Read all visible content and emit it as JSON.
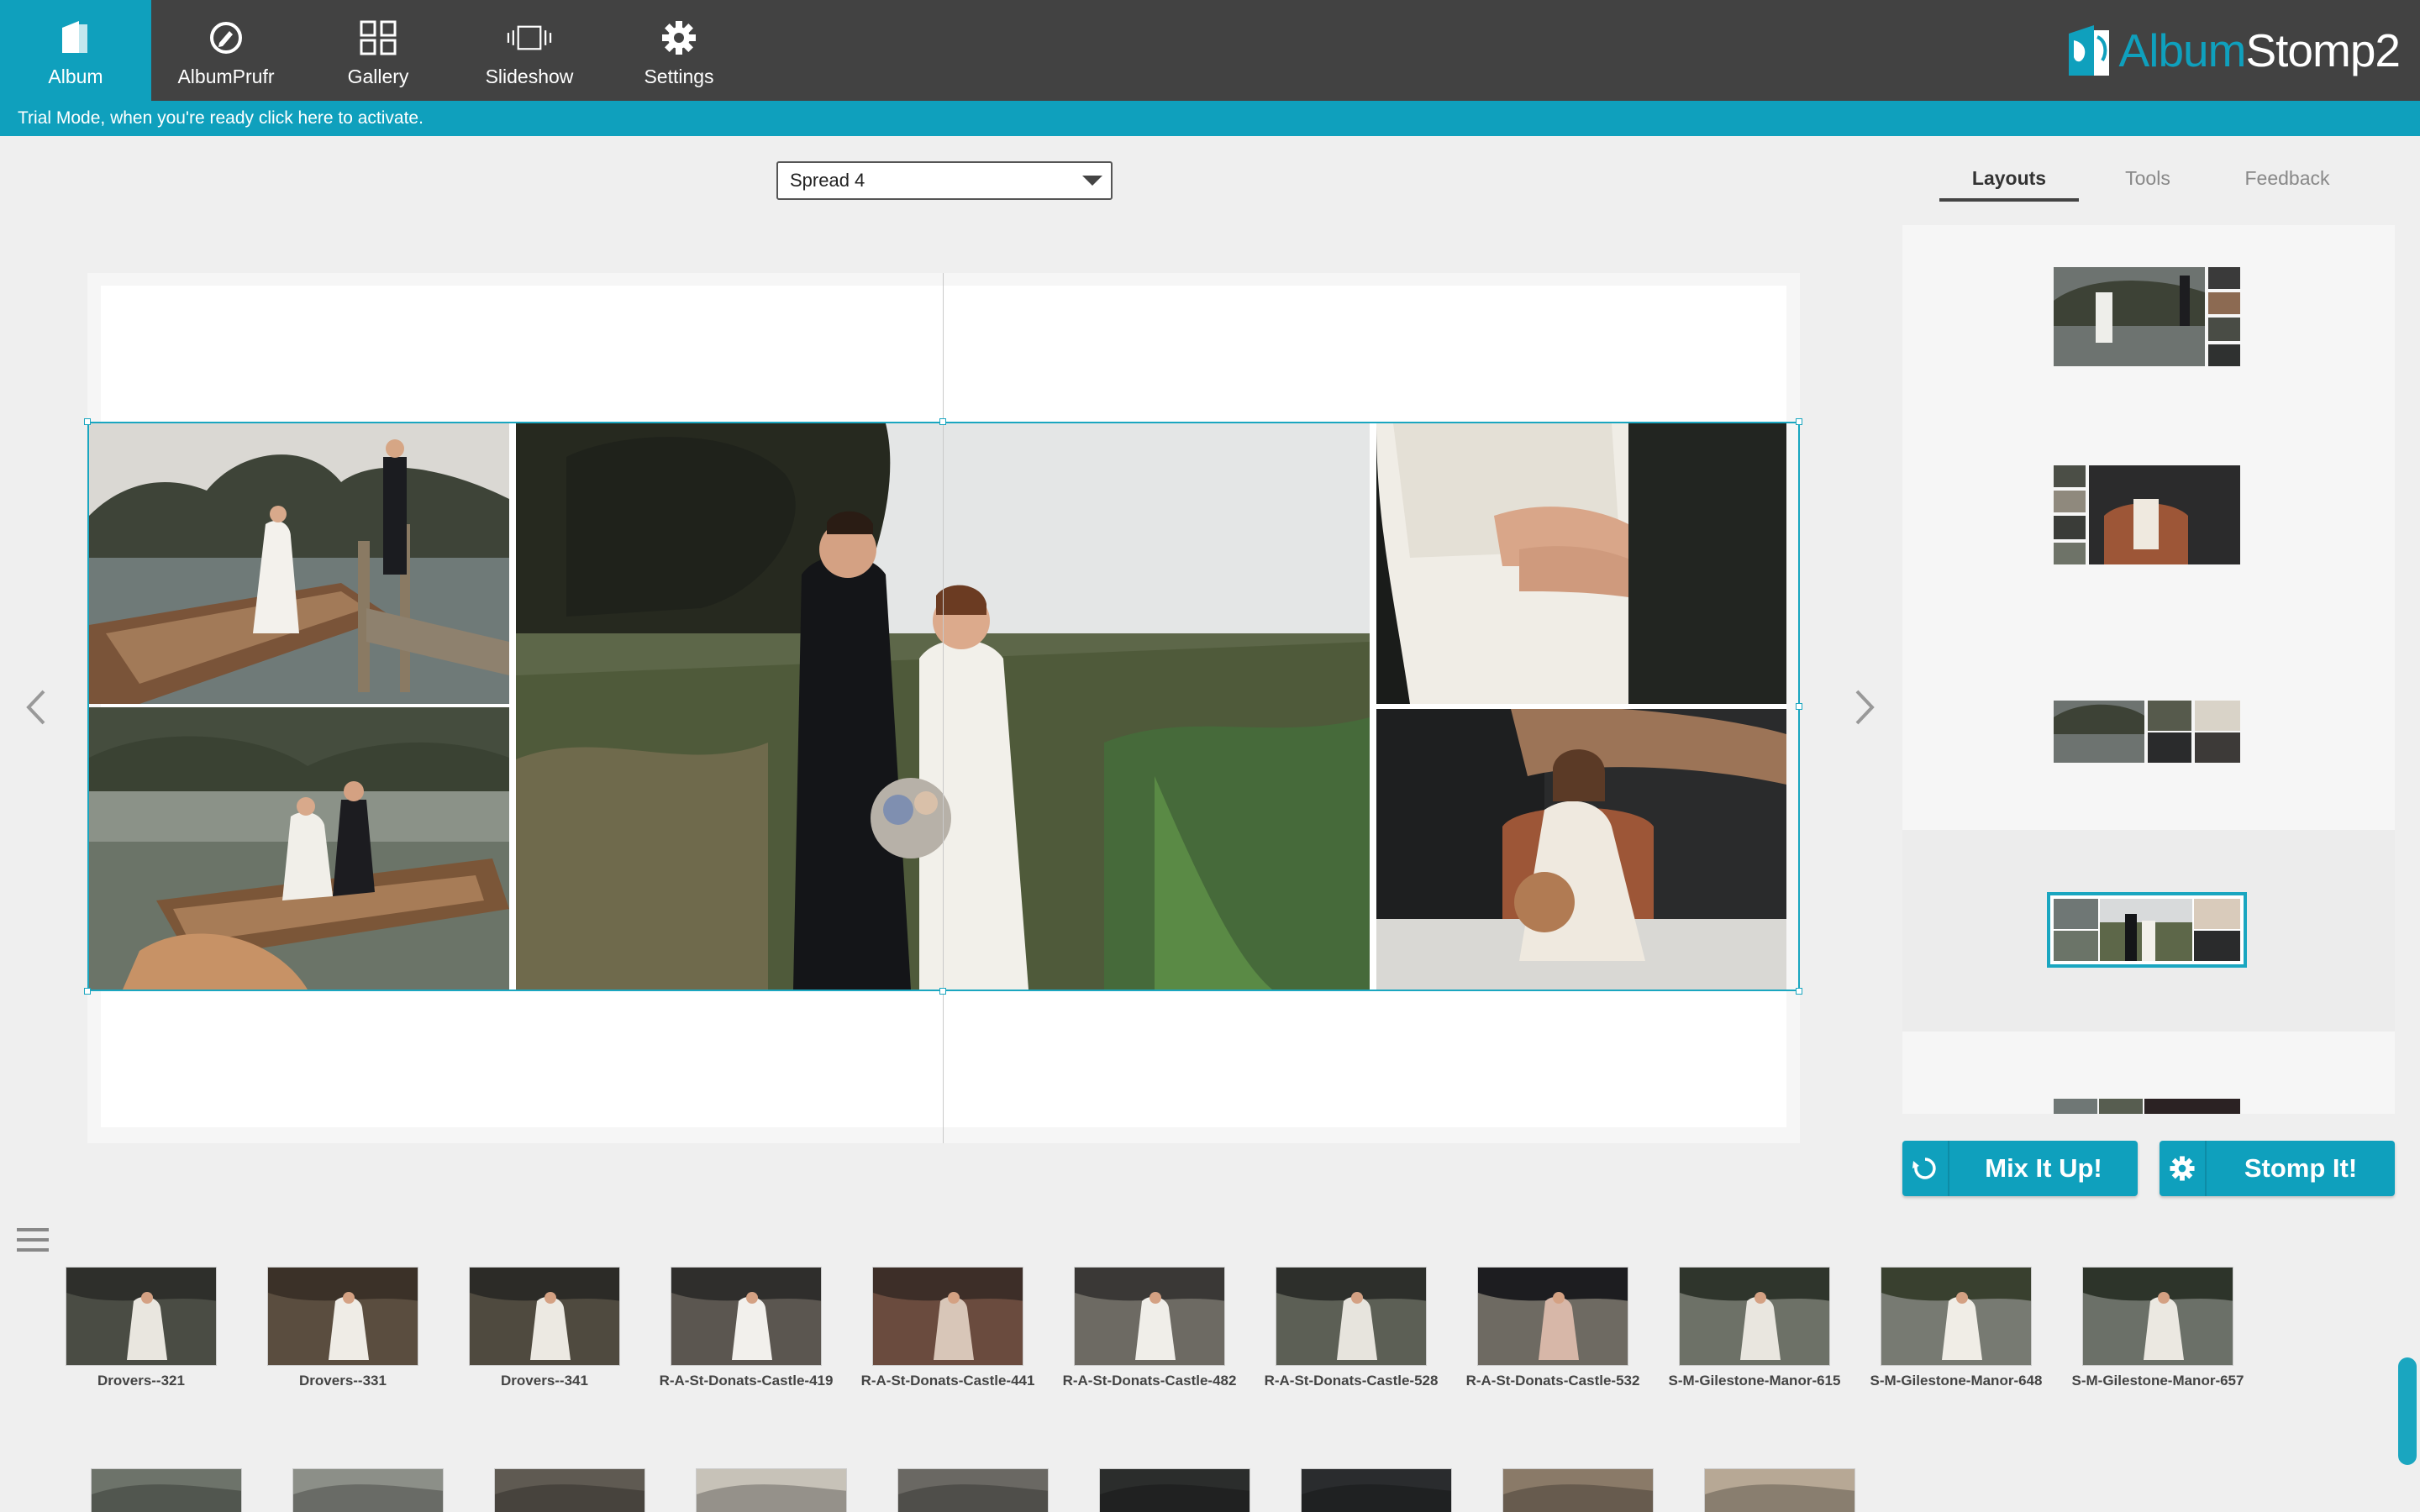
{
  "nav": {
    "items": [
      {
        "label": "Album",
        "icon": "album-icon"
      },
      {
        "label": "AlbumPrufr",
        "icon": "albumprufr-icon"
      },
      {
        "label": "Gallery",
        "icon": "gallery-icon"
      },
      {
        "label": "Slideshow",
        "icon": "slideshow-icon"
      },
      {
        "label": "Settings",
        "icon": "gear-icon"
      }
    ],
    "active": "Album"
  },
  "brand": {
    "part1": "Album",
    "part2": "Stomp2"
  },
  "trial": {
    "message": "Trial Mode, when you're ready click here to activate."
  },
  "spread_select": {
    "value": "Spread 4"
  },
  "tabs": [
    {
      "label": "Layouts",
      "active": true
    },
    {
      "label": "Tools",
      "active": false
    },
    {
      "label": "Feedback",
      "active": false
    }
  ],
  "buttons": {
    "mix": "Mix It Up!",
    "stomp": "Stomp It!"
  },
  "filmstrip": {
    "row1": [
      "Drovers--321",
      "Drovers--331",
      "Drovers--341",
      "R-A-St-Donats-Castle-419",
      "R-A-St-Donats-Castle-441",
      "R-A-St-Donats-Castle-482",
      "R-A-St-Donats-Castle-528",
      "R-A-St-Donats-Castle-532",
      "S-M-Gilestone-Manor-615",
      "S-M-Gilestone-Manor-648",
      "S-M-Gilestone-Manor-657"
    ]
  },
  "colors": {
    "accent": "#0fa0bd",
    "nav_bg": "#424242",
    "selection": "#1aa6c0"
  }
}
